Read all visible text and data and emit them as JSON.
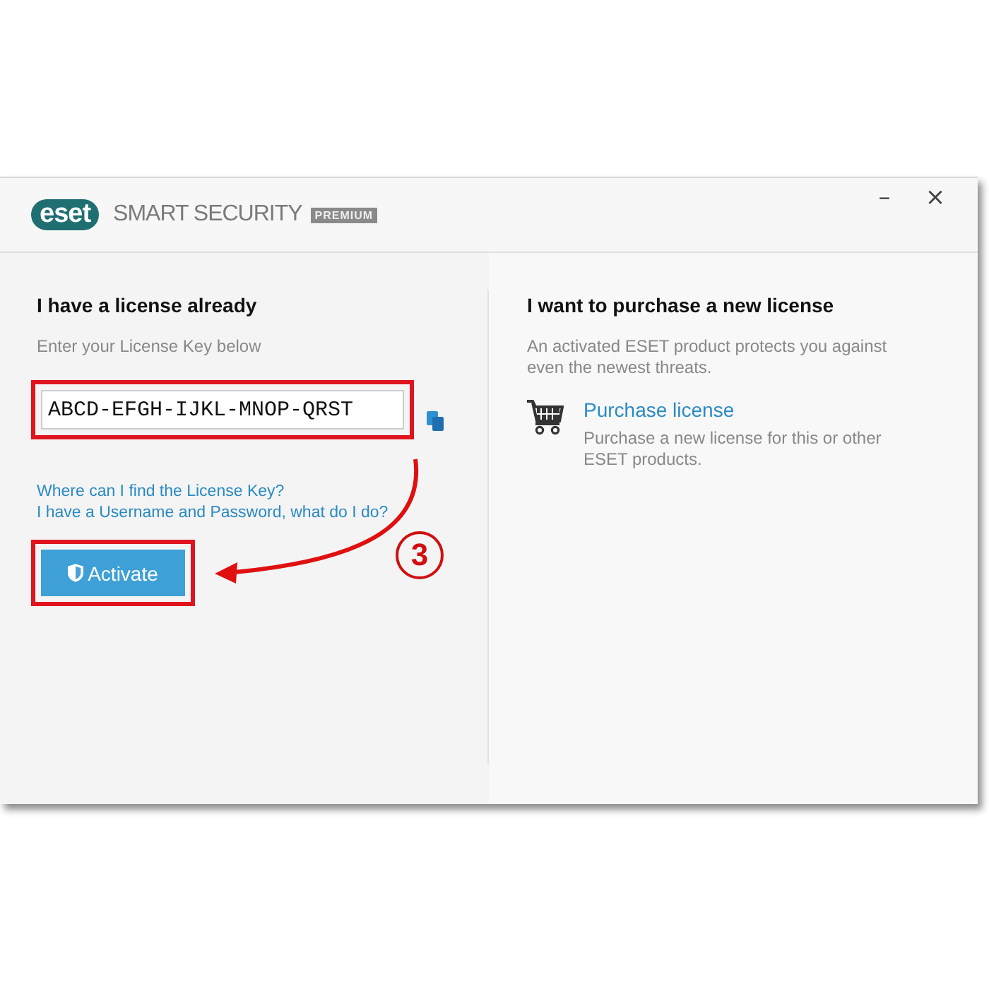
{
  "window": {
    "logo": "eset",
    "product": "SMART SECURITY",
    "edition": "PREMIUM",
    "controls": [
      "–",
      "×"
    ]
  },
  "have_license": {
    "title": "I have a license already",
    "hint": "Enter your License Key below",
    "license_key": "ABCD-EFGH-IJKL-MNOP-QRST",
    "links": [
      "Where can I find the License Key?",
      "I have a Username and Password, what do I do?"
    ],
    "button": "Activate"
  },
  "purchase": {
    "title": "I want to purchase a new license",
    "description": "An activated ESET product protects you against even the newest threats.",
    "link": "Purchase license",
    "link_description": "Purchase a new license for this or other ESET products."
  },
  "annotation": {
    "step": "3"
  }
}
